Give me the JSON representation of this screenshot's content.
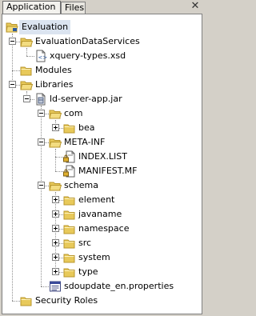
{
  "tabs": [
    {
      "label": "Application",
      "active": true
    },
    {
      "label": "Files",
      "active": false
    }
  ],
  "close_label": "✕",
  "tree": [
    {
      "label": "Evaluation",
      "depth": 0,
      "toggle": "none",
      "icon": "project-folder-icon",
      "selected": true
    },
    {
      "label": "EvaluationDataServices",
      "depth": 1,
      "toggle": "minus",
      "icon": "folder-open-icon"
    },
    {
      "label": "xquery-types.xsd",
      "depth": 2,
      "toggle": "none",
      "icon": "xsd-file-icon"
    },
    {
      "label": "Modules",
      "depth": 1,
      "toggle": "none",
      "icon": "folder-icon"
    },
    {
      "label": "Libraries",
      "depth": 1,
      "toggle": "minus",
      "icon": "folder-open-icon"
    },
    {
      "label": "ld-server-app.jar",
      "depth": 2,
      "toggle": "minus",
      "icon": "jar-icon"
    },
    {
      "label": "com",
      "depth": 3,
      "toggle": "minus",
      "icon": "folder-open-icon"
    },
    {
      "label": "bea",
      "depth": 4,
      "toggle": "plus",
      "icon": "folder-icon"
    },
    {
      "label": "META-INF",
      "depth": 3,
      "toggle": "minus",
      "icon": "folder-open-icon"
    },
    {
      "label": "INDEX.LIST",
      "depth": 4,
      "toggle": "none",
      "icon": "locked-file-icon"
    },
    {
      "label": "MANIFEST.MF",
      "depth": 4,
      "toggle": "none",
      "icon": "locked-file-icon"
    },
    {
      "label": "schema",
      "depth": 3,
      "toggle": "minus",
      "icon": "folder-open-icon"
    },
    {
      "label": "element",
      "depth": 4,
      "toggle": "plus",
      "icon": "folder-icon"
    },
    {
      "label": "javaname",
      "depth": 4,
      "toggle": "plus",
      "icon": "folder-icon"
    },
    {
      "label": "namespace",
      "depth": 4,
      "toggle": "plus",
      "icon": "folder-icon"
    },
    {
      "label": "src",
      "depth": 4,
      "toggle": "plus",
      "icon": "folder-icon"
    },
    {
      "label": "system",
      "depth": 4,
      "toggle": "plus",
      "icon": "folder-icon"
    },
    {
      "label": "type",
      "depth": 4,
      "toggle": "plus",
      "icon": "folder-icon"
    },
    {
      "label": "sdoupdate_en.properties",
      "depth": 3,
      "toggle": "none",
      "icon": "properties-file-icon"
    },
    {
      "label": "Security Roles",
      "depth": 1,
      "toggle": "none",
      "icon": "folder-icon"
    }
  ],
  "colors": {
    "folder": "#e8c95a",
    "folder_dark": "#b8962c",
    "selection": "#dbe4f0",
    "accent": "#2c5aa0"
  }
}
